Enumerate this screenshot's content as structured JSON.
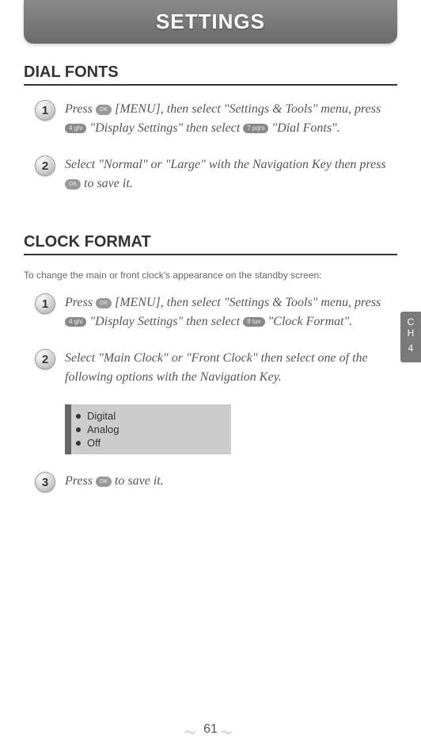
{
  "header": {
    "title": "SETTINGS"
  },
  "sections": {
    "dial_fonts": {
      "title": "DIAL FONTS",
      "steps": {
        "s1": {
          "num": "1",
          "t1": "Press ",
          "t2": " [MENU], then select \"Settings & Tools\" menu, press ",
          "t3": " \"Display Settings\" then select ",
          "t4": " \"Dial Fonts\"."
        },
        "s2": {
          "num": "2",
          "t1": "Select \"Normal\" or \"Large\" with the Navigation Key then press ",
          "t2": " to save it."
        }
      }
    },
    "clock_format": {
      "title": "CLOCK FORMAT",
      "subtitle": "To change the main or front clock's appearance on the standby screen:",
      "steps": {
        "s1": {
          "num": "1",
          "t1": "Press ",
          "t2": " [MENU], then select \"Settings & Tools\" menu, press ",
          "t3": " \"Display Settings\" then select ",
          "t4": " \"Clock Format\"."
        },
        "s2": {
          "num": "2",
          "text": "Select \"Main Clock\" or \"Front Clock\" then select one of the following options with the Navigation Key."
        },
        "s3": {
          "num": "3",
          "t1": "Press ",
          "t2": " to save it."
        }
      },
      "options": {
        "o1": "Digital",
        "o2": "Analog",
        "o3": "Off"
      }
    }
  },
  "keys": {
    "ok": "OK",
    "k4": "4 ghi",
    "k7": "7 pqrs",
    "k8": "8 tuv"
  },
  "sidetab": {
    "l1": "C",
    "l2": "H",
    "l3": "4"
  },
  "page": "61"
}
